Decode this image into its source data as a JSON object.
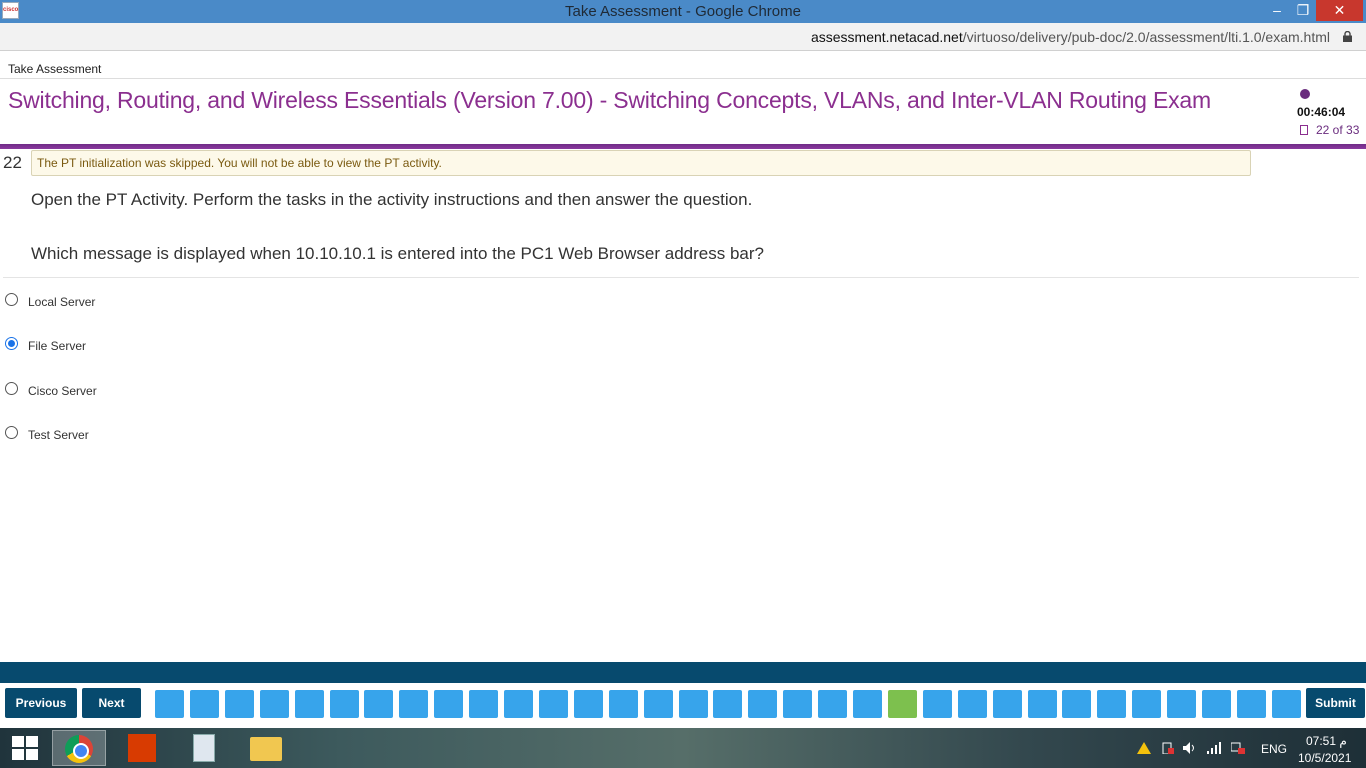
{
  "window": {
    "title": "Take Assessment - Google Chrome",
    "app_icon_text": "cisco",
    "minimize_symbol": "–",
    "maximize_symbol": "❐",
    "close_symbol": "✕"
  },
  "browser": {
    "url_host": "assessment.netacad.net",
    "url_path": "/virtuoso/delivery/pub-doc/2.0/assessment/lti.1.0/exam.html"
  },
  "page": {
    "breadcrumb": "Take Assessment",
    "exam_title": "Switching, Routing, and Wireless Essentials (Version 7.00) - Switching Concepts, VLANs, and Inter-VLAN Routing Exam",
    "timer": "00:46:04",
    "progress": "22 of 33"
  },
  "question": {
    "number": "22",
    "notice": "The PT initialization was skipped. You will not be able to view the PT activity.",
    "instruction": "Open the PT Activity. Perform the tasks in the activity instructions and then answer the question.",
    "prompt": "Which message is displayed when 10.10.10.1 is entered into the PC1 Web Browser address bar?",
    "options": [
      {
        "label": "Local Server",
        "selected": false
      },
      {
        "label": "File Server",
        "selected": true
      },
      {
        "label": "Cisco Server",
        "selected": false
      },
      {
        "label": "Test Server",
        "selected": false
      }
    ]
  },
  "navigation": {
    "previous_label": "Previous",
    "next_label": "Next",
    "submit_label": "Submit",
    "question_count": 33,
    "current_question": 22,
    "colors": {
      "bar": "#074a6e",
      "question": "#37a4eb",
      "current": "#7dc04e"
    }
  },
  "taskbar": {
    "apps": [
      "windows-start",
      "google-chrome",
      "adobe-acrobat",
      "calculator",
      "file-explorer"
    ],
    "language": "ENG",
    "time": "07:51 م",
    "date": "10/5/2021"
  }
}
